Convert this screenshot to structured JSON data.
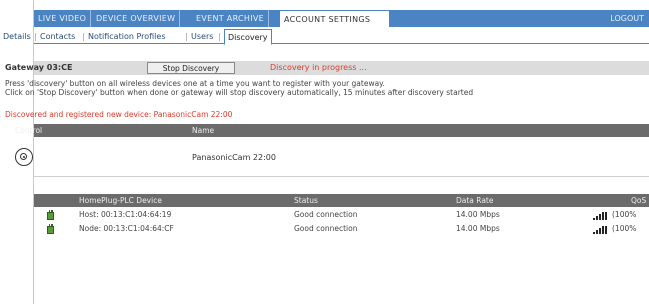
{
  "topnav": {
    "tabs": [
      "LIVE VIDEO",
      "DEVICE OVERVIEW",
      "EVENT ARCHIVE",
      "ACCOUNT SETTINGS"
    ],
    "active_tab": "ACCOUNT SETTINGS",
    "logout": "LOGOUT"
  },
  "subnav": {
    "tabs": [
      "Details",
      "Contacts",
      "Notification Profiles",
      "Users",
      "Discovery"
    ],
    "active_tab": "Discovery",
    "separator": "|"
  },
  "gateway": {
    "name": "Gateway 03:CE",
    "stop_button": "Stop Discovery",
    "status": "Discovery in progress ..."
  },
  "instructions": {
    "line1": "Press 'discovery' button on all wireless devices one at a time you want to register with your gateway.",
    "line2": "Click on 'Stop Discovery' button when done or gateway will stop discovery automatically, 15 minutes after discovery started"
  },
  "discovered_message": "Discovered and registered new device: PanasonicCam 22:00",
  "devices_table": {
    "headers": {
      "control": "Control",
      "name": "Name"
    },
    "rows": [
      {
        "icon": "camera-icon",
        "name": "PanasonicCam 22:00"
      }
    ]
  },
  "plc_table": {
    "headers": {
      "device": "HomePlug-PLC Device",
      "status": "Status",
      "rate": "Data Rate",
      "qos": "QoS"
    },
    "rows": [
      {
        "icon": "plug-icon",
        "device": "Host: 00:13:C1:04:64:19",
        "status": "Good connection",
        "rate": "14.00 Mbps",
        "qos": "(100%"
      },
      {
        "icon": "plug-icon",
        "device": "Node: 00:13:C1:04:64:CF",
        "status": "Good connection",
        "rate": "14.00 Mbps",
        "qos": "(100%"
      }
    ]
  },
  "colors": {
    "nav_blue": "#4a84c2",
    "alert_red": "#e03a2a",
    "header_gray": "#6b6b6b",
    "bar_gray": "#dcdcdc",
    "plug_green": "#5a9a3a"
  }
}
